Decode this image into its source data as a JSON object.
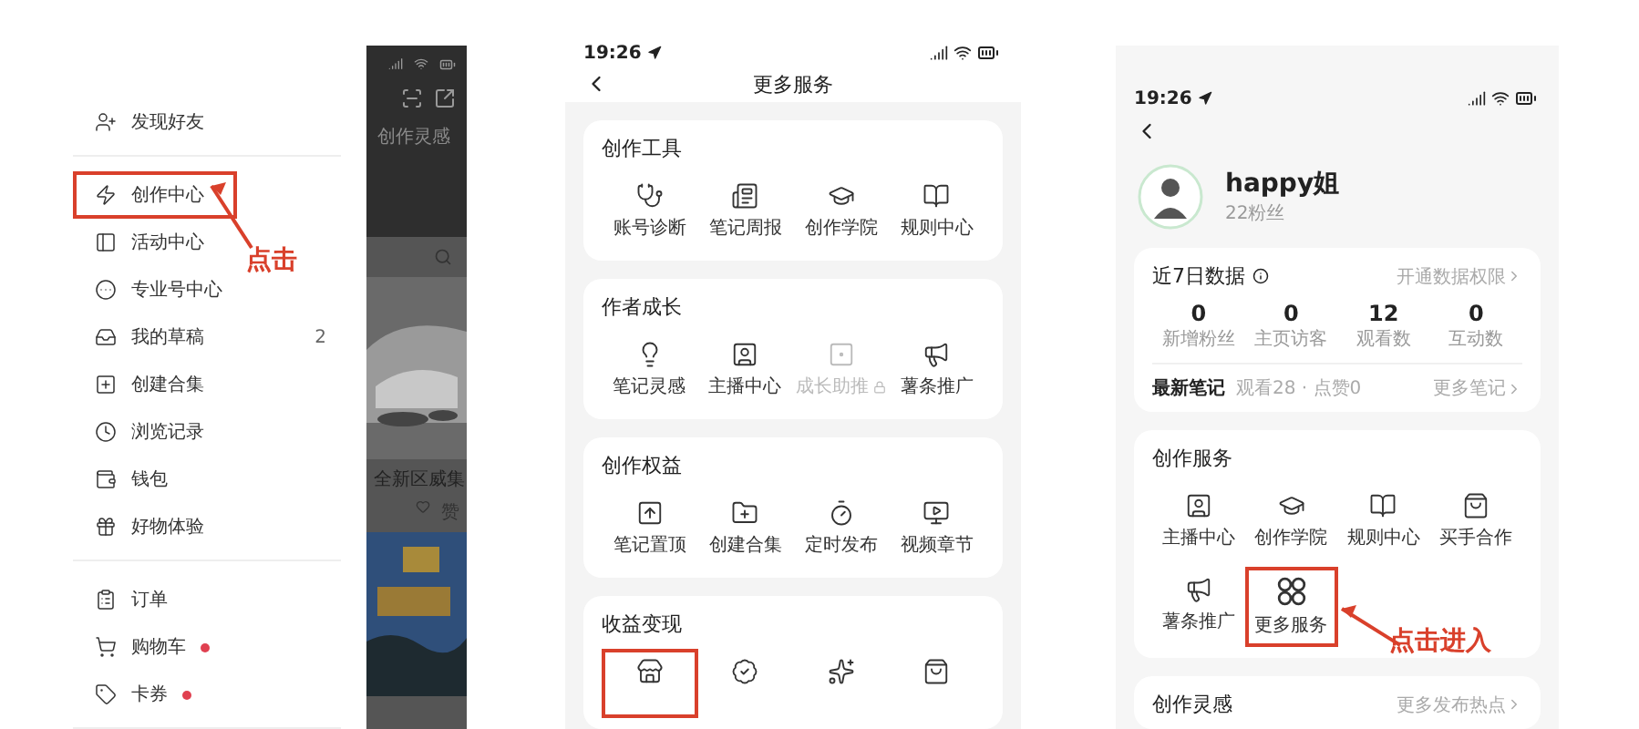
{
  "drawer_screen": {
    "menu_groups": [
      [
        {
          "label": "发现好友",
          "highlighted": false,
          "dot": false
        }
      ],
      [
        {
          "label": "创作中心",
          "highlighted": true,
          "dot": false
        },
        {
          "label": "活动中心",
          "highlighted": false,
          "dot": false
        },
        {
          "label": "专业号中心",
          "highlighted": false,
          "dot": false
        },
        {
          "label": "我的草稿",
          "highlighted": false,
          "dot": false,
          "count": "2"
        },
        {
          "label": "创建合集",
          "highlighted": false,
          "dot": false
        },
        {
          "label": "浏览记录",
          "highlighted": false,
          "dot": false
        },
        {
          "label": "钱包",
          "highlighted": false,
          "dot": false
        },
        {
          "label": "好物体验",
          "highlighted": false,
          "dot": false
        }
      ],
      [
        {
          "label": "订单",
          "highlighted": false,
          "dot": false
        },
        {
          "label": "购物车",
          "highlighted": false,
          "dot": true
        },
        {
          "label": "卡券",
          "highlighted": false,
          "dot": true
        }
      ]
    ],
    "background_page": {
      "header_label": "创作灵感",
      "post_title": "全新区威集",
      "like_label": "赞"
    },
    "annotation": "点击"
  },
  "more_services_screen": {
    "status_bar": {
      "time": "19:26"
    },
    "title": "更多服务",
    "sections": [
      {
        "title": "创作工具",
        "items": [
          {
            "label": "账号诊断",
            "disabled": false,
            "highlighted": false
          },
          {
            "label": "笔记周报",
            "disabled": false,
            "highlighted": false
          },
          {
            "label": "创作学院",
            "disabled": false,
            "highlighted": false
          },
          {
            "label": "规则中心",
            "disabled": false,
            "highlighted": false
          }
        ]
      },
      {
        "title": "作者成长",
        "items": [
          {
            "label": "笔记灵感",
            "disabled": false,
            "highlighted": false
          },
          {
            "label": "主播中心",
            "disabled": false,
            "highlighted": false
          },
          {
            "label": "成长助推",
            "disabled": true,
            "highlighted": false
          },
          {
            "label": "薯条推广",
            "disabled": false,
            "highlighted": false
          }
        ]
      },
      {
        "title": "创作权益",
        "items": [
          {
            "label": "笔记置顶",
            "disabled": false,
            "highlighted": false
          },
          {
            "label": "创建合集",
            "disabled": false,
            "highlighted": false
          },
          {
            "label": "定时发布",
            "disabled": false,
            "highlighted": false
          },
          {
            "label": "视频章节",
            "disabled": false,
            "highlighted": false
          }
        ]
      },
      {
        "title": "收益变现",
        "items": [
          {
            "disabled": false,
            "highlighted": true
          },
          {
            "disabled": false,
            "highlighted": false
          },
          {
            "disabled": false,
            "highlighted": false
          },
          {
            "disabled": false,
            "highlighted": false
          }
        ]
      }
    ]
  },
  "creator_screen": {
    "status_bar": {
      "time": "19:26"
    },
    "profile": {
      "name": "happy姐",
      "followers": "22粉丝"
    },
    "stats_card": {
      "title": "近7日数据",
      "link": "开通数据权限",
      "stats": [
        {
          "value": "0",
          "label": "新增粉丝"
        },
        {
          "value": "0",
          "label": "主页访客"
        },
        {
          "value": "12",
          "label": "观看数"
        },
        {
          "value": "0",
          "label": "互动数"
        }
      ],
      "latest_note": {
        "title": "最新笔记",
        "meta": "观看28 · 点赞0",
        "link": "更多笔记"
      }
    },
    "services_card": {
      "title": "创作服务",
      "items": [
        {
          "label": "主播中心",
          "highlighted": false
        },
        {
          "label": "创作学院",
          "highlighted": false
        },
        {
          "label": "规则中心",
          "highlighted": false
        },
        {
          "label": "买手合作",
          "highlighted": false
        },
        {
          "label": "薯条推广",
          "highlighted": false
        },
        {
          "label": "更多服务",
          "highlighted": true
        }
      ]
    },
    "inspiration_card": {
      "title": "创作灵感",
      "link": "更多发布热点"
    },
    "annotation": "点击进入"
  }
}
